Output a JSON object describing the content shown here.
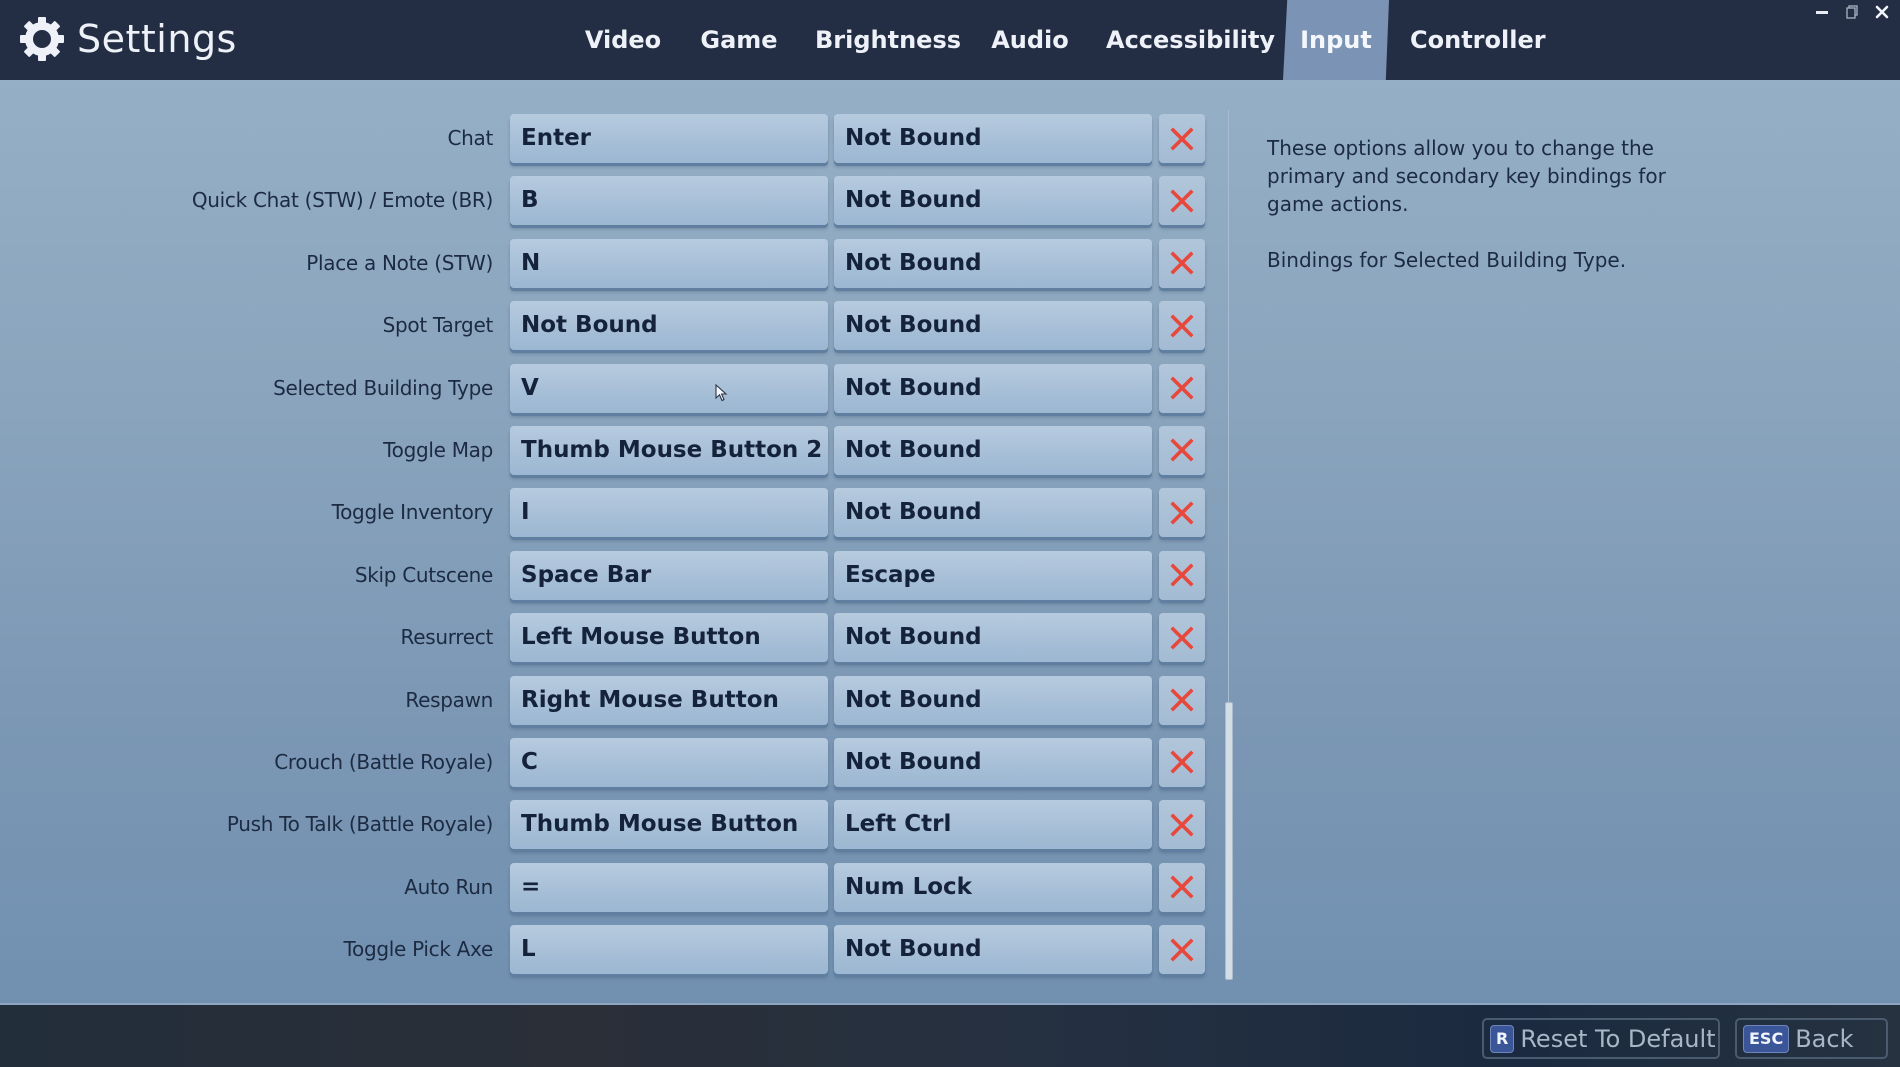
{
  "header": {
    "title": "Settings",
    "logo_icon": "gear-icon",
    "tabs": [
      {
        "label": "Video",
        "active": false
      },
      {
        "label": "Game",
        "active": false
      },
      {
        "label": "Brightness",
        "active": false
      },
      {
        "label": "Audio",
        "active": false
      },
      {
        "label": "Accessibility",
        "active": false
      },
      {
        "label": "Input",
        "active": true
      },
      {
        "label": "Controller",
        "active": false
      }
    ],
    "window_controls": [
      "minimize-icon",
      "restore-icon",
      "close-icon"
    ]
  },
  "bindings": [
    {
      "action": "Chat",
      "primary": "Enter",
      "secondary": "Not Bound"
    },
    {
      "action": "Quick Chat (STW) / Emote (BR)",
      "primary": "B",
      "secondary": "Not Bound"
    },
    {
      "action": "Place a Note (STW)",
      "primary": "N",
      "secondary": "Not Bound"
    },
    {
      "action": "Spot Target",
      "primary": "Not Bound",
      "secondary": "Not Bound"
    },
    {
      "action": "Selected Building Type",
      "primary": "V",
      "secondary": "Not Bound"
    },
    {
      "action": "Toggle Map",
      "primary": "Thumb Mouse Button 2",
      "secondary": "Not Bound"
    },
    {
      "action": "Toggle Inventory",
      "primary": "I",
      "secondary": "Not Bound"
    },
    {
      "action": "Skip Cutscene",
      "primary": "Space Bar",
      "secondary": "Escape"
    },
    {
      "action": "Resurrect",
      "primary": "Left Mouse Button",
      "secondary": "Not Bound"
    },
    {
      "action": "Respawn",
      "primary": "Right Mouse Button",
      "secondary": "Not Bound"
    },
    {
      "action": "Crouch (Battle Royale)",
      "primary": "C",
      "secondary": "Not Bound"
    },
    {
      "action": "Push To Talk (Battle Royale)",
      "primary": "Thumb Mouse Button",
      "secondary": "Left Ctrl"
    },
    {
      "action": "Auto Run",
      "primary": "=",
      "secondary": "Num Lock"
    },
    {
      "action": "Toggle Pick Axe",
      "primary": "L",
      "secondary": "Not Bound"
    }
  ],
  "clear_icon": "close-x-icon",
  "scrollbar": {
    "position_fraction": 0.68,
    "visible_fraction": 0.32
  },
  "description": {
    "paragraph1": "These options allow you to change the primary and secondary key bindings for game actions.",
    "paragraph2": "Bindings for Selected Building Type."
  },
  "footer": {
    "reset": {
      "key": "R",
      "label": "Reset To Default"
    },
    "back": {
      "key": "ESC",
      "label": "Back"
    }
  },
  "colors": {
    "header_bg": "#232e45",
    "active_tab_bg": "#7b93b4",
    "clear_x": "#e8473b",
    "key_hint_bg": "#3b5599"
  }
}
